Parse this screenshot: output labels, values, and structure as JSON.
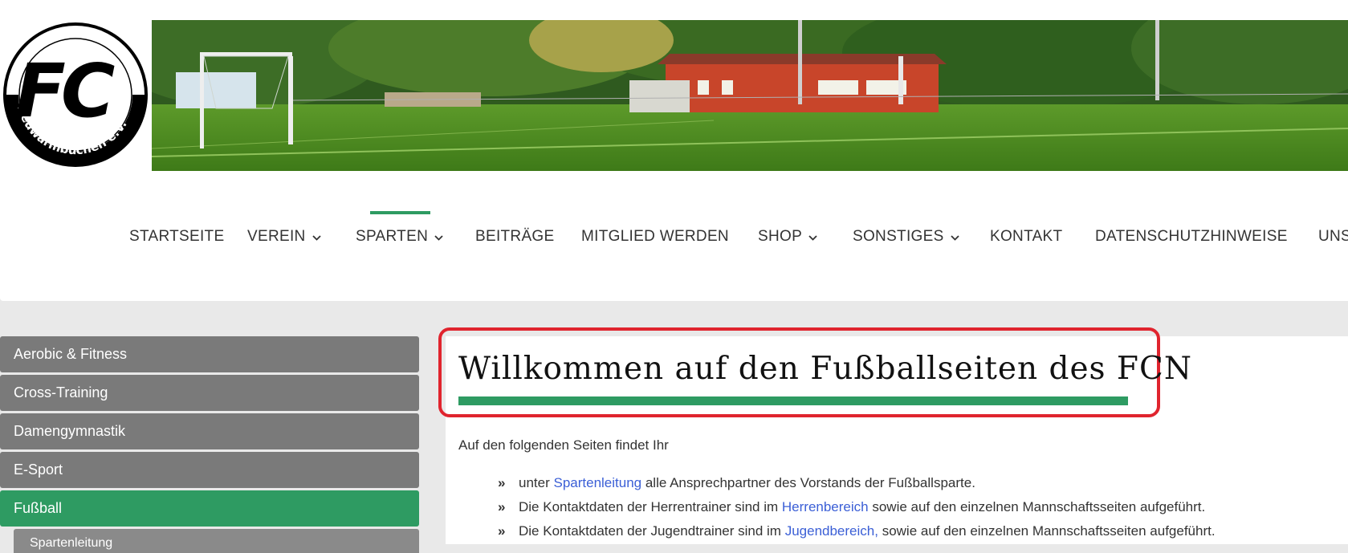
{
  "logo": {
    "letters": "FC",
    "ring_text": "Neuwarmbüchen e.V."
  },
  "nav": {
    "items": [
      {
        "label": "STARTSEITE",
        "has_dropdown": false
      },
      {
        "label": "VEREIN",
        "has_dropdown": true
      },
      {
        "label": "SPARTEN",
        "has_dropdown": true,
        "active": true
      },
      {
        "label": "BEITRÄGE",
        "has_dropdown": false
      },
      {
        "label": "MITGLIED WERDEN",
        "has_dropdown": false
      },
      {
        "label": "SHOP",
        "has_dropdown": true
      },
      {
        "label": "SONSTIGES",
        "has_dropdown": true
      },
      {
        "label": "KONTAKT",
        "has_dropdown": false
      },
      {
        "label": "DATENSCHUTZHINWEISE",
        "has_dropdown": false
      },
      {
        "label": "UNS",
        "has_dropdown": false
      }
    ]
  },
  "sidebar": {
    "items": [
      {
        "label": "Aerobic & Fitness"
      },
      {
        "label": "Cross-Training"
      },
      {
        "label": "Damengymnastik"
      },
      {
        "label": "E-Sport"
      },
      {
        "label": "Fußball",
        "active": true
      }
    ],
    "sub_item": "Spartenleitung"
  },
  "main": {
    "title": "Willkommen auf den Fußballseiten des FCN",
    "intro": "Auf den folgenden Seiten findet Ihr",
    "bullets": [
      {
        "before": "unter ",
        "link": "Spartenleitung",
        "after": " alle Ansprechpartner des Vorstands der Fußballsparte."
      },
      {
        "before": "Die Kontaktdaten der Herrentrainer sind im ",
        "link": "Herrenbereich",
        "after": " sowie auf den einzelnen Mannschaftsseiten aufgeführt."
      },
      {
        "before": "Die Kontaktdaten der Jugendtrainer sind im ",
        "link": "Jugendbereich,",
        "after": " sowie auf den einzelnen Mannschaftsseiten aufgeführt."
      }
    ],
    "bullet_mark": "»"
  },
  "colors": {
    "accent": "#2e9b62",
    "sidebar_gray": "#7a7a7a",
    "highlight_red": "#e0242e",
    "link": "#3b5fd6"
  }
}
